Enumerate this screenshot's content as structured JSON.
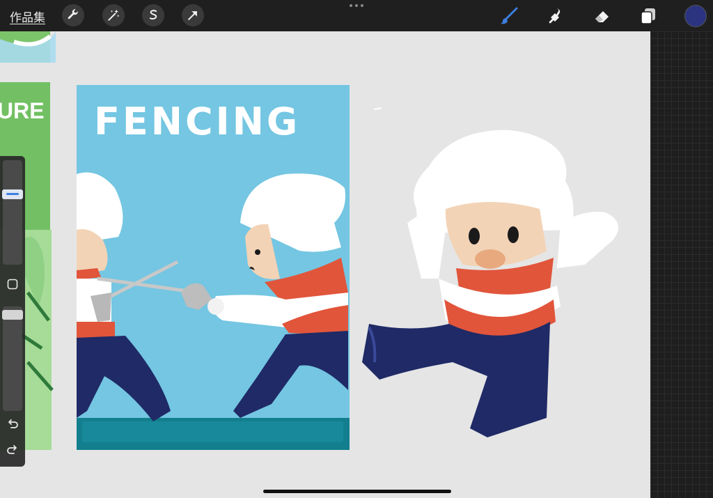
{
  "topbar": {
    "gallery_label": "作品集",
    "left_tools": [
      {
        "name": "actions",
        "icon": "wrench-icon"
      },
      {
        "name": "adjustments",
        "icon": "magic-wand-icon"
      },
      {
        "name": "selection",
        "icon": "selection-s-icon"
      },
      {
        "name": "transform",
        "icon": "arrow-cursor-icon"
      }
    ],
    "right_tools": [
      {
        "name": "brush",
        "icon": "brush-icon",
        "active": true
      },
      {
        "name": "smudge",
        "icon": "smudge-icon"
      },
      {
        "name": "eraser",
        "icon": "eraser-icon"
      },
      {
        "name": "layers",
        "icon": "layers-icon"
      }
    ],
    "current_color": "#2a3480",
    "accent_color": "#3e7fe0"
  },
  "canvas": {
    "poster_title": "FENCING",
    "left_partial_text": "URE",
    "colors": {
      "sky": "#74c6e2",
      "floor": "#137e8e",
      "navy": "#1f2a66",
      "red": "#e1553b",
      "skin": "#f3d3b6",
      "white": "#ffffff",
      "green": "#5cb85c"
    }
  },
  "sidebar": {
    "brush_size_level": 0.15,
    "opacity_level": 0.05,
    "modify_icon": "square-icon",
    "undo_icon": "undo-icon",
    "redo_icon": "redo-icon"
  }
}
